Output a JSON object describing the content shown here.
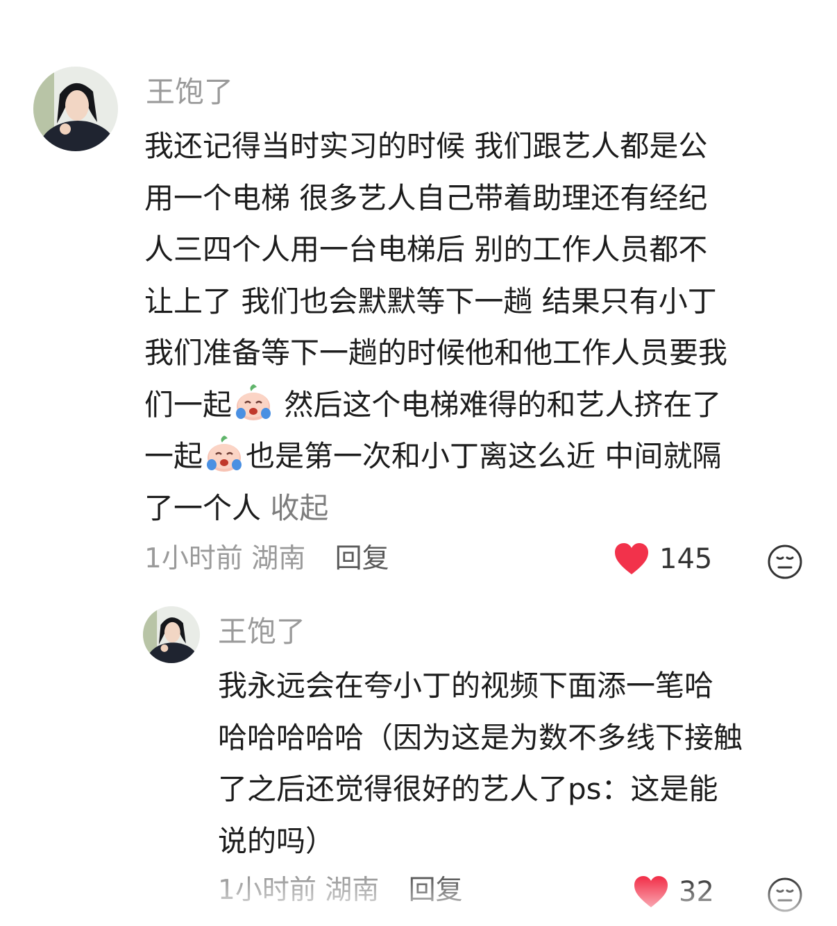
{
  "comment": {
    "author": "王饱了",
    "lines": [
      "我还记得当时实习的时候 我们跟艺人都是公",
      "用一个电梯 很多艺人自己带着助理还有经纪",
      "人三四个人用一台电梯后 别的工作人员都不",
      "让上了 我们也会默默等下一趟 结果只有小丁",
      "我们准备等下一趟的时候他和他工作人员要我"
    ],
    "line6_a": "们一起",
    "line6_b": " 然后这个电梯难得的和艺人挤在了",
    "line7_a": "一起",
    "line7_b": "也是第一次和小丁离这么近 中间就隔",
    "line8": "了一个人 ",
    "collapse": "收起",
    "time": "1小时前",
    "location": "湖南",
    "reply_label": "回复",
    "likes": "145"
  },
  "reply": {
    "author": "王饱了",
    "lines": [
      "我永远会在夸小丁的视频下面添一笔哈",
      "哈哈哈哈哈（因为这是为数不多线下接触",
      "了之后还觉得很好的艺人了ps：这是能",
      "说的吗）"
    ],
    "time": "1小时前",
    "location": "湖南",
    "reply_label": "回复",
    "likes": "32"
  },
  "colors": {
    "heart": "#f2324b",
    "author": "#9a9a9a",
    "text": "#1c1c1c"
  },
  "icons": [
    "avatar-photo",
    "crying-emoji",
    "heart-icon",
    "dislike-face-icon"
  ]
}
